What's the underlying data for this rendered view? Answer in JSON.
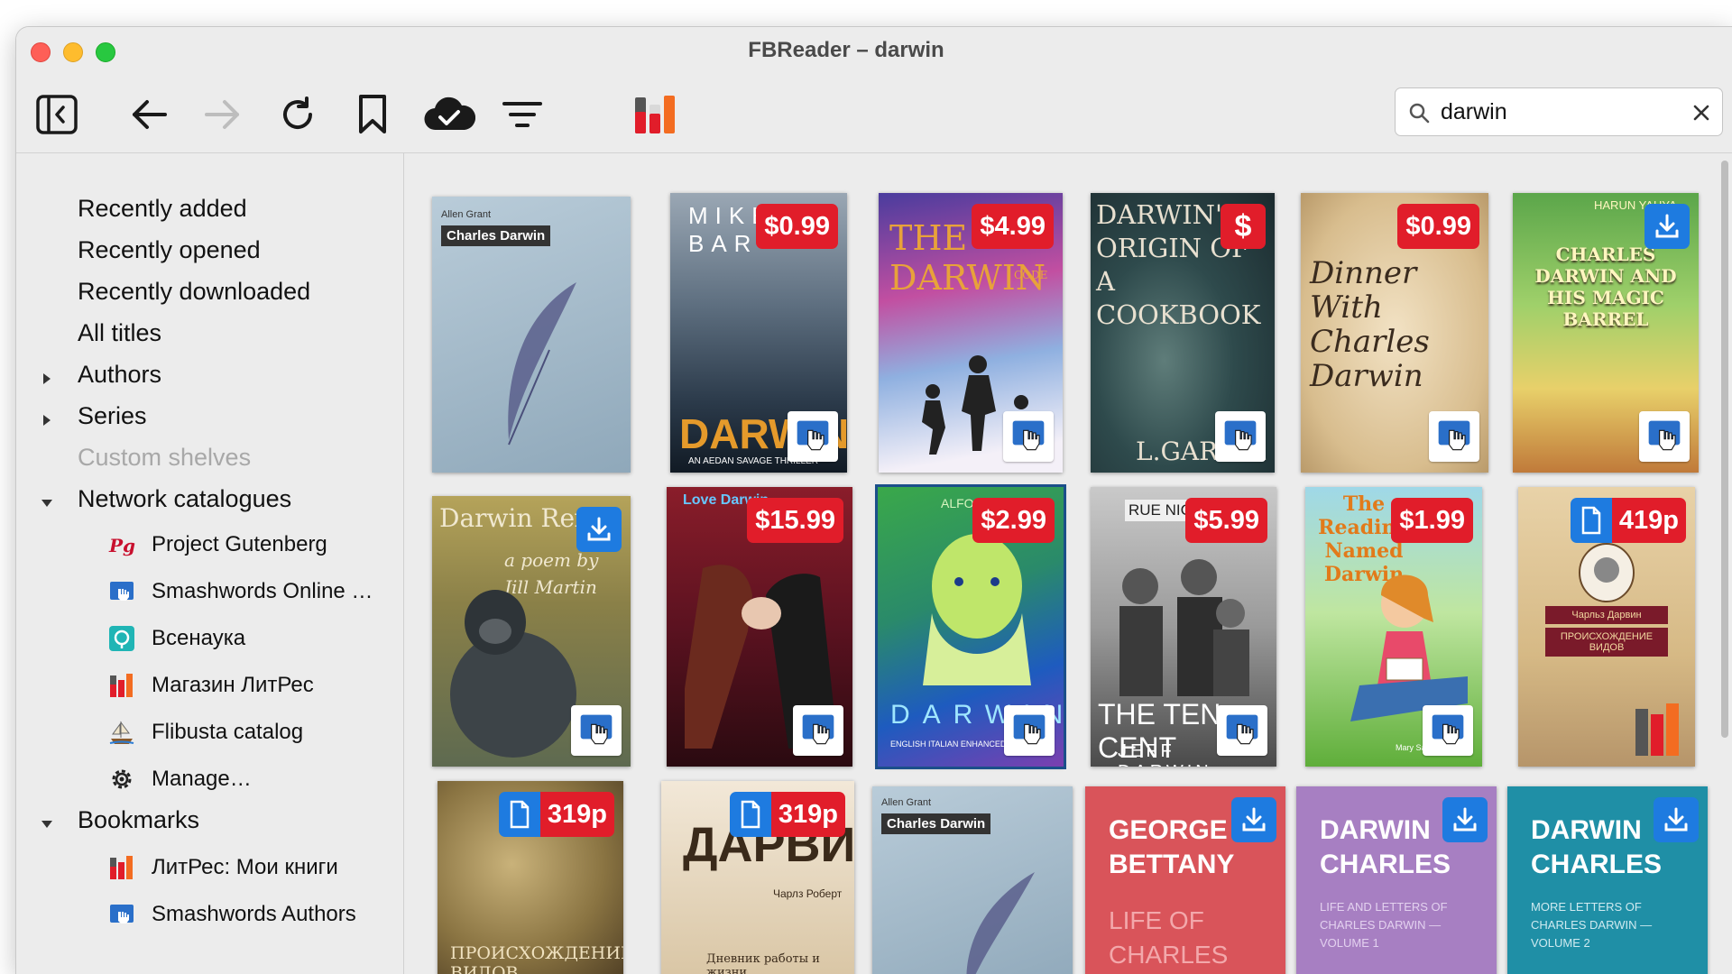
{
  "window": {
    "title": "FBReader – darwin"
  },
  "toolbar": {
    "sidebar_toggle": "sidebar-toggle-icon",
    "back": "arrow-left-icon",
    "forward": "arrow-right-icon",
    "reload": "reload-icon",
    "bookmark": "bookmark-icon",
    "cloud": "cloud-check-icon",
    "filter": "filter-icon",
    "litres": "litres-logo-icon"
  },
  "search": {
    "value": "darwin",
    "placeholder": ""
  },
  "sidebar": {
    "items": [
      {
        "label": "Recently added"
      },
      {
        "label": "Recently opened"
      },
      {
        "label": "Recently downloaded"
      },
      {
        "label": "All titles"
      },
      {
        "label": "Authors"
      },
      {
        "label": "Series"
      },
      {
        "label": "Custom shelves"
      },
      {
        "label": "Network catalogues"
      },
      {
        "label": "Bookmarks"
      }
    ],
    "catalogues": [
      {
        "label": "Project Gutenberg",
        "icon": "project-gutenberg-icon"
      },
      {
        "label": "Smashwords Online …",
        "icon": "smashwords-icon"
      },
      {
        "label": "Всенаука",
        "icon": "vsenauka-icon"
      },
      {
        "label": "Магазин ЛитРес",
        "icon": "litres-icon"
      },
      {
        "label": "Flibusta catalog",
        "icon": "flibusta-icon"
      },
      {
        "label": "Manage…",
        "icon": "gear-icon"
      }
    ],
    "bookmarks": [
      {
        "label": "ЛитРес: Мои книги",
        "icon": "litres-icon"
      },
      {
        "label": "Smashwords Authors",
        "icon": "smashwords-icon"
      }
    ]
  },
  "books": [
    {
      "author": "Allen Grant",
      "title": "Charles Darwin",
      "badge": ""
    },
    {
      "title": "MIKE BAR",
      "line2": "DARWIN",
      "line3": "AN AEDAN SAVAGE THRILLER",
      "badge": "$0.99"
    },
    {
      "title": "THE DARWIN",
      "line2": "CODE",
      "badge": "$4.99"
    },
    {
      "title": "DARWIN'S ORIGIN OF A COOKBOOK",
      "line2": "L.GARCIA",
      "badge": "$"
    },
    {
      "title": "Dinner With Charles Darwin",
      "badge": "$0.99"
    },
    {
      "title": "HARUN YAHYA",
      "line2": "CHARLES DARWIN AND HIS MAGIC BARREL",
      "badge": "download"
    },
    {
      "title": "Darwin Rex",
      "line2": "a poem by Jill Martin",
      "badge": "download"
    },
    {
      "title": "Love Darwin",
      "badge": "$15.99"
    },
    {
      "title": "ALFONSO",
      "line2": "DARWIN",
      "line3": "ENGLISH ITALIAN ENHANCED",
      "badge": "$2.99"
    },
    {
      "title": "RUE NICHOLS",
      "line2": "THE TEN CENT",
      "line3": "JEFF DARWIN",
      "badge": "$5.99"
    },
    {
      "title": "The Reading Named Darwin",
      "line2": "Mary Sage",
      "badge": "$1.99"
    },
    {
      "title": "Чарльз Дарвин",
      "line2": "ПРОИСХОЖДЕНИЕ ВИДОВ",
      "badge": "419р"
    },
    {
      "title": "ПРОИСХОЖДЕНИЕ ВИДОВ",
      "badge": "319р"
    },
    {
      "title": "ДАРВИН",
      "line2": "Чарлз Роберт",
      "line3": "Дневник работы и жизни",
      "badge": "319р"
    },
    {
      "author": "Allen Grant",
      "title": "Charles Darwin",
      "badge": ""
    },
    {
      "title": "GEORGE BETTANY",
      "line2": "LIFE OF CHARLES DARWIN",
      "badge": "download"
    },
    {
      "title": "DARWIN CHARLES",
      "line2": "LIFE AND LETTERS OF CHARLES DARWIN — VOLUME 1",
      "badge": "download"
    },
    {
      "title": "DARWIN CHARLES",
      "line2": "MORE LETTERS OF CHARLES DARWIN — VOLUME 2",
      "badge": "download"
    }
  ]
}
